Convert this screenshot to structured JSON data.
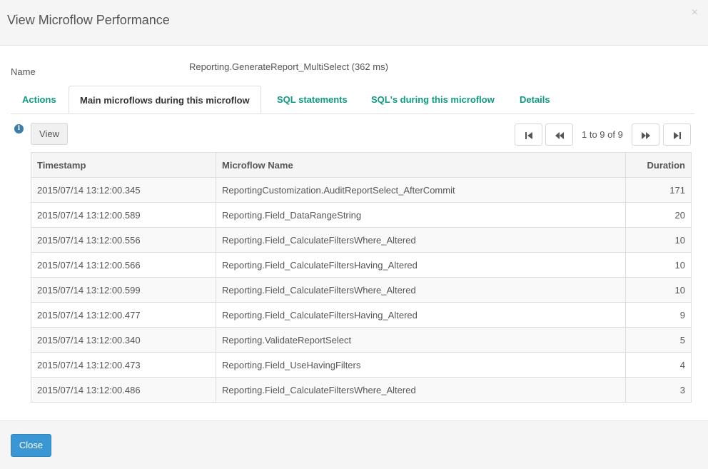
{
  "dialog": {
    "title": "View Microflow Performance",
    "close_icon": "×"
  },
  "name_row": {
    "label": "Name",
    "value": "Reporting.GenerateReport_MultiSelect (362 ms)"
  },
  "tabs": [
    {
      "label": "Actions",
      "active": false
    },
    {
      "label": "Main microflows during this microflow",
      "active": true
    },
    {
      "label": "SQL statements",
      "active": false
    },
    {
      "label": "SQL's during this microflow",
      "active": false
    },
    {
      "label": "Details",
      "active": false
    }
  ],
  "toolbar": {
    "info_icon": "info-icon",
    "view_label": "View"
  },
  "pager": {
    "text": "1 to 9 of 9",
    "icons": [
      "first-page-icon",
      "previous-page-icon",
      "next-page-icon",
      "last-page-icon"
    ]
  },
  "table": {
    "headers": [
      "Timestamp",
      "Microflow Name",
      "Duration"
    ],
    "rows": [
      [
        "2015/07/14 13:12:00.345",
        "ReportingCustomization.AuditReportSelect_AfterCommit",
        "171"
      ],
      [
        "2015/07/14 13:12:00.589",
        "Reporting.Field_DataRangeString",
        "20"
      ],
      [
        "2015/07/14 13:12:00.556",
        "Reporting.Field_CalculateFiltersWhere_Altered",
        "10"
      ],
      [
        "2015/07/14 13:12:00.566",
        "Reporting.Field_CalculateFiltersHaving_Altered",
        "10"
      ],
      [
        "2015/07/14 13:12:00.599",
        "Reporting.Field_CalculateFiltersWhere_Altered",
        "10"
      ],
      [
        "2015/07/14 13:12:00.477",
        "Reporting.Field_CalculateFiltersHaving_Altered",
        "9"
      ],
      [
        "2015/07/14 13:12:00.340",
        "Reporting.ValidateReportSelect",
        "5"
      ],
      [
        "2015/07/14 13:12:00.473",
        "Reporting.Field_UseHavingFilters",
        "4"
      ],
      [
        "2015/07/14 13:12:00.486",
        "Reporting.Field_CalculateFiltersWhere_Altered",
        "3"
      ]
    ]
  },
  "footer": {
    "close_label": "Close"
  },
  "colors": {
    "tab_link": "#0f9a82",
    "primary_button": "#3b97d3",
    "info_icon": "#3a7da8"
  }
}
